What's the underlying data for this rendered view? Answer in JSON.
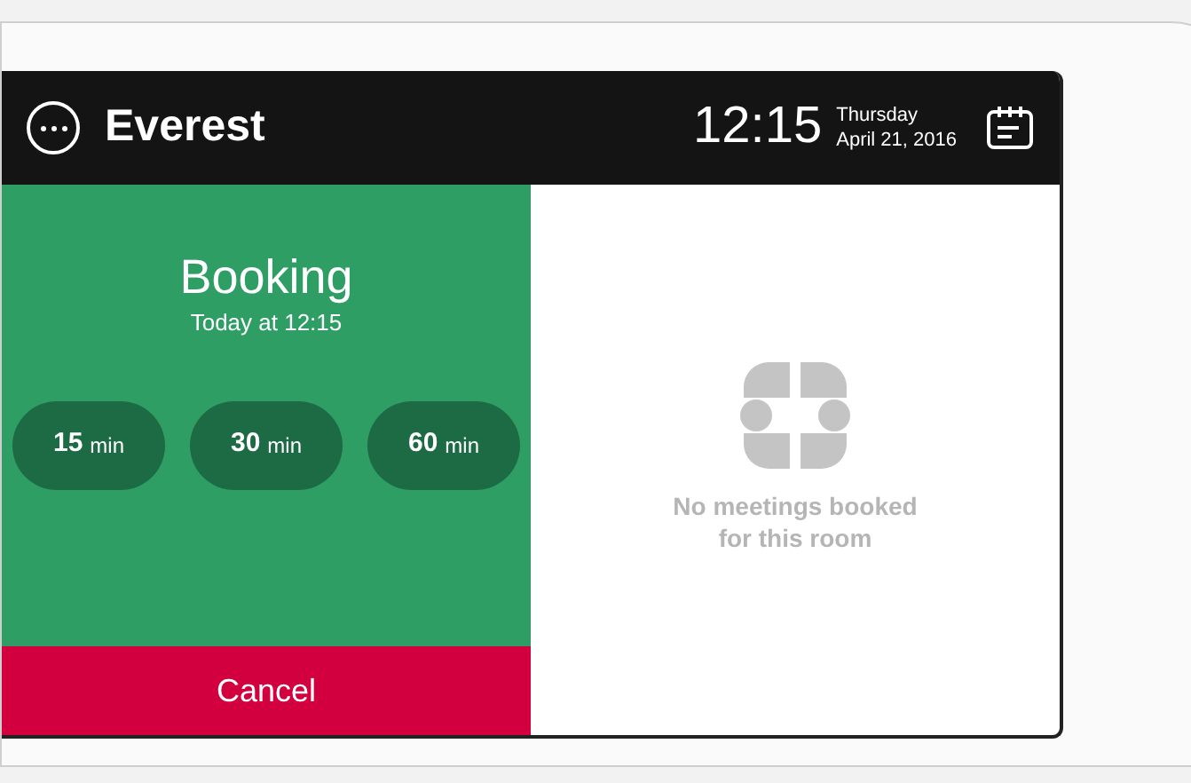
{
  "header": {
    "room": "Everest",
    "time": "12:15",
    "weekday": "Thursday",
    "date": "April 21, 2016"
  },
  "booking": {
    "title": "Booking",
    "subtitle": "Today at 12:15",
    "durations": [
      {
        "value": "15",
        "unit": "min"
      },
      {
        "value": "30",
        "unit": "min"
      },
      {
        "value": "60",
        "unit": "min"
      }
    ],
    "cancel": "Cancel"
  },
  "schedule": {
    "empty_message": "No meetings booked for this room"
  }
}
